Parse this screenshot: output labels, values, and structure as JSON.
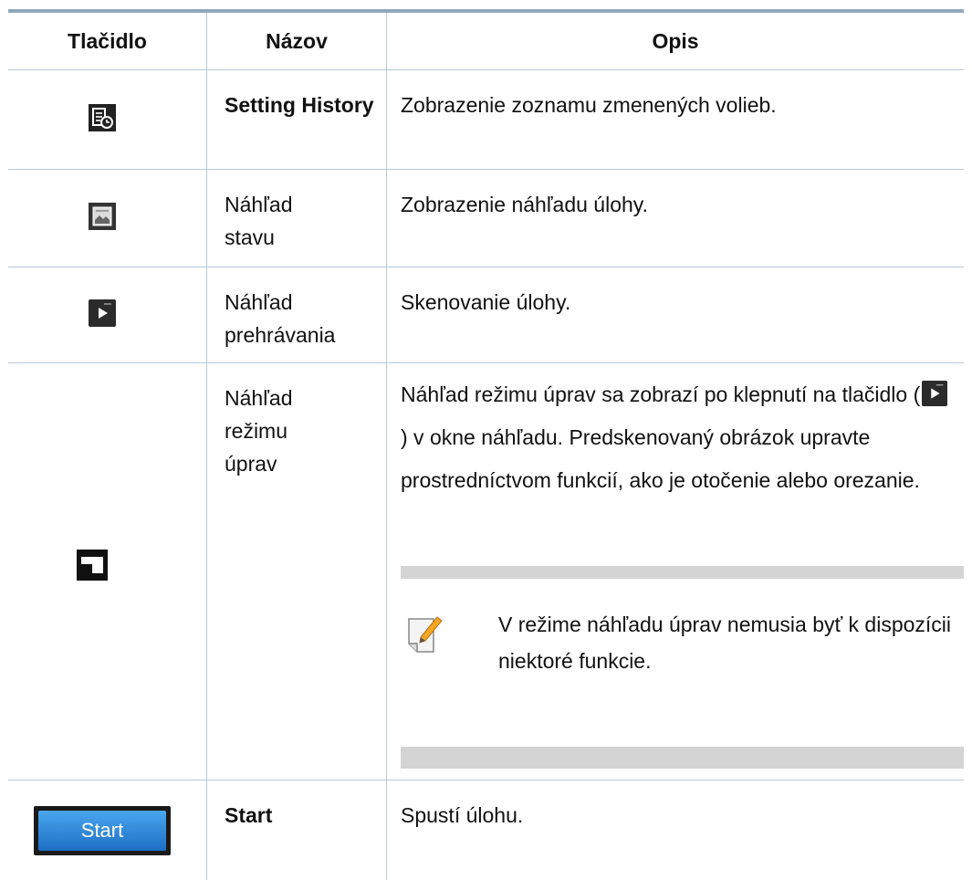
{
  "table": {
    "headers": {
      "button": "Tlačidlo",
      "name": "Názov",
      "description": "Opis"
    },
    "rows": [
      {
        "icon": "setting-history-icon",
        "name": "Setting History",
        "desc": "Zobrazenie zoznamu zmenených volieb."
      },
      {
        "icon": "status-preview-icon",
        "name": "Náhľad stavu",
        "desc": "Zobrazenie náhľadu úlohy."
      },
      {
        "icon": "play-preview-icon",
        "name": "Náhľad prehrávania",
        "desc": "Skenovanie úlohy."
      },
      {
        "icon": "edit-mode-preview-icon",
        "name": "Náhľad režimu úprav",
        "desc_before": "Náhľad režimu úprav sa zobrazí po klepnutí na tlačidlo (",
        "desc_after": ") v okne náhľadu. Predskenovaný obrázok upravte prostredníctvom funkcií, ako je otočenie alebo orezanie.",
        "note": "V režime náhľadu úprav nemusia byť k dispozícii niektoré funkcie."
      },
      {
        "icon": "start-button",
        "button_label": "Start",
        "name": "Start",
        "desc": "Spustí úlohu."
      }
    ]
  }
}
